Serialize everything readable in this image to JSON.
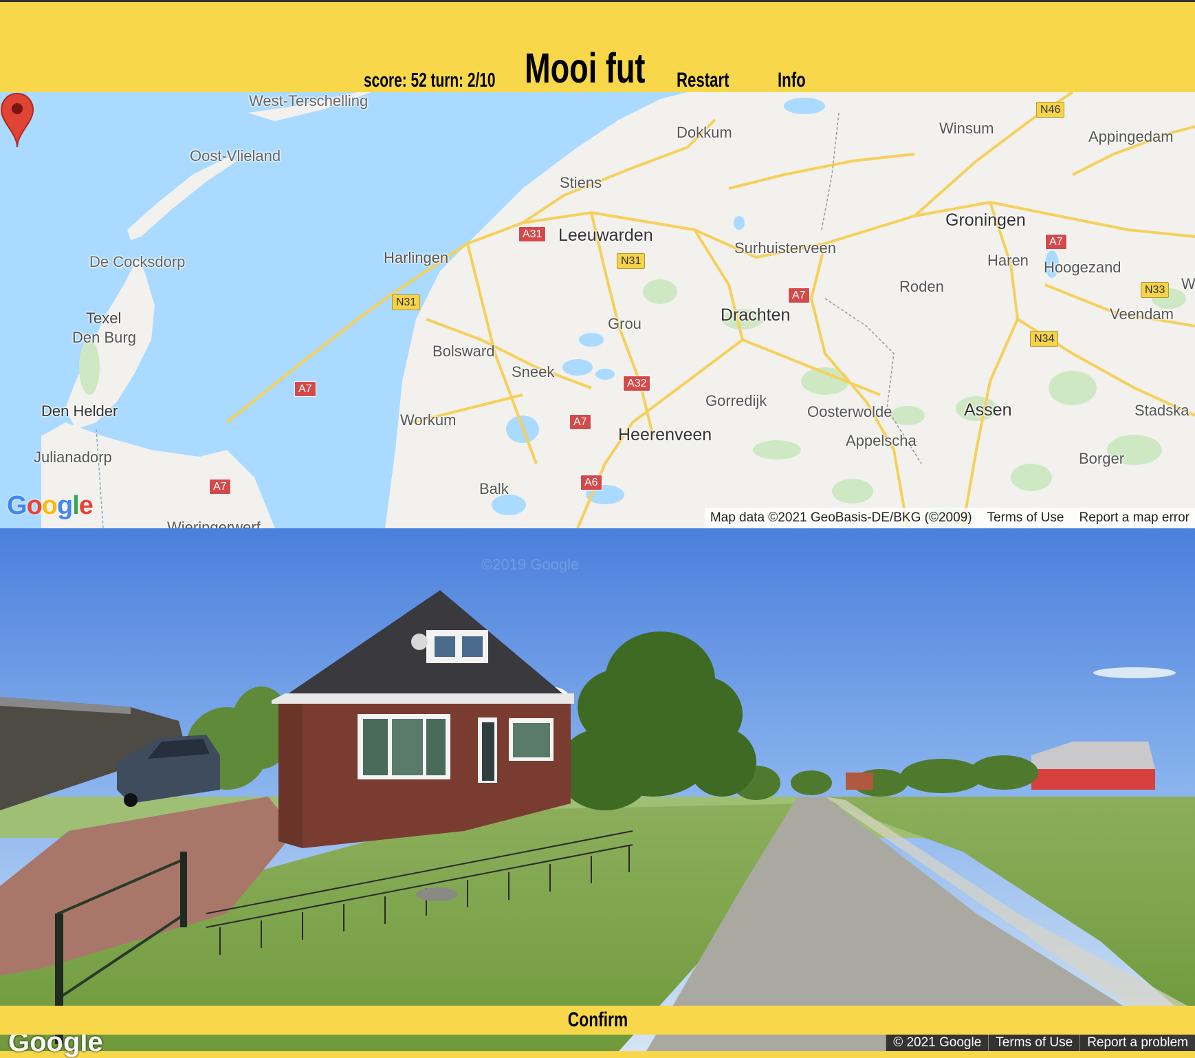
{
  "header": {
    "score_turn": "score: 52 turn: 2/10",
    "title": "Mooi fut",
    "restart_label": "Restart",
    "info_label": "Info"
  },
  "map": {
    "places": {
      "west_terschelling": "West-Terschelling",
      "oost_vlieland": "Oost-Vlieland",
      "de_cocksdorp": "De Cocksdorp",
      "texel": "Texel",
      "den_burg": "Den Burg",
      "den_helder": "Den Helder",
      "julianadorp": "Julianadorp",
      "wieringerwerf": "Wieringerwerf",
      "harlingen": "Harlingen",
      "leeuwarden": "Leeuwarden",
      "stiens": "Stiens",
      "dokkum": "Dokkum",
      "surhuisterveen": "Surhuisterveen",
      "winsum": "Winsum",
      "appingedam": "Appingedam",
      "groningen": "Groningen",
      "haren": "Haren",
      "hoogezand": "Hoogezand",
      "roden": "Roden",
      "veendam": "Veendam",
      "drachten": "Drachten",
      "grou": "Grou",
      "bolsward": "Bolsward",
      "sneek": "Sneek",
      "workum": "Workum",
      "gorredijk": "Gorredijk",
      "oosterwolde": "Oosterwolde",
      "appelscha": "Appelscha",
      "assen": "Assen",
      "stadska": "Stadska",
      "heerenveen": "Heerenveen",
      "balk": "Balk",
      "borger": "Borger",
      "w": "W"
    },
    "shields": {
      "a31": "A31",
      "n31_a": "N31",
      "n31_b": "N31",
      "a7_a": "A7",
      "a7_b": "A7",
      "a7_c": "A7",
      "a7_d": "A7",
      "a7_e": "A7",
      "a32": "A32",
      "a6": "A6",
      "n46": "N46",
      "n33": "N33",
      "n34": "N34"
    },
    "logo": "Google",
    "attribution": "Map data ©2021 GeoBasis-DE/BKG (©2009)",
    "terms": "Terms of Use",
    "report": "Report a map error"
  },
  "streetview": {
    "watermark": "©2019 Google",
    "logo": "Google",
    "copyright": "© 2021 Google",
    "terms": "Terms of Use",
    "report": "Report a problem"
  },
  "confirm_label": "Confirm",
  "colors": {
    "header_bg": "#f8d84a",
    "water": "#aadaff",
    "land": "#f2f1ee",
    "road": "#f6d05a",
    "marker": "#e04434"
  }
}
